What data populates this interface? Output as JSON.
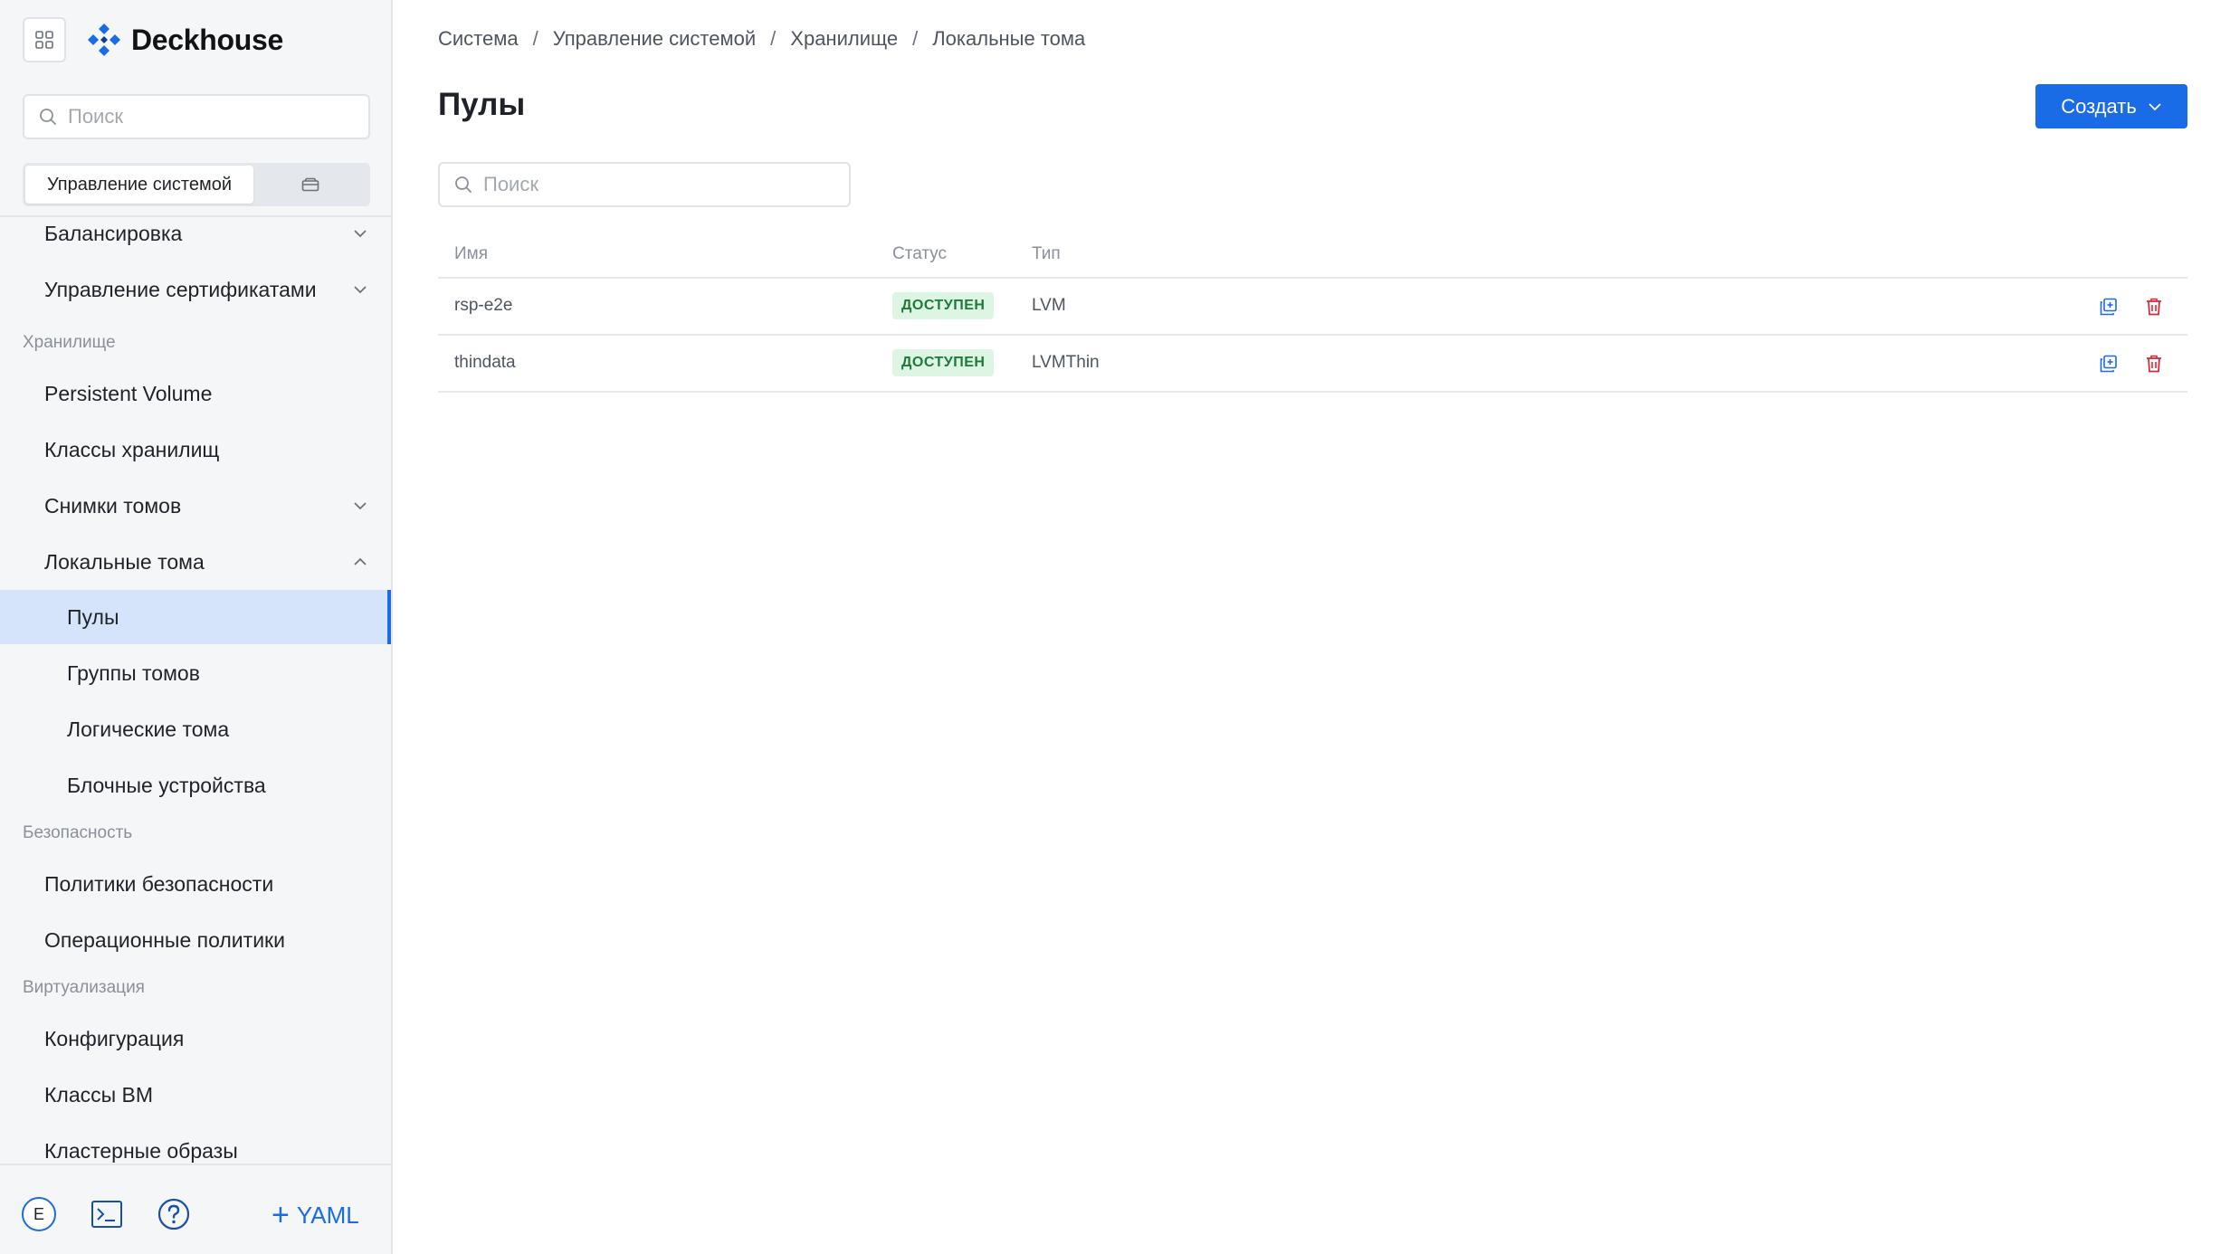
{
  "brand": {
    "name": "Deckhouse",
    "accent": "#1a6be6"
  },
  "sidebar": {
    "search_placeholder": "Поиск",
    "mode_active": "Управление системой",
    "mode_other_icon": "package-icon",
    "items": [
      {
        "label": "Балансировка",
        "expand": "down"
      },
      {
        "label": "Управление сертификатами",
        "expand": "down"
      },
      {
        "section": "Хранилище"
      },
      {
        "label": "Persistent Volume"
      },
      {
        "label": "Классы хранилищ"
      },
      {
        "label": "Снимки томов",
        "expand": "down"
      },
      {
        "label": "Локальные тома",
        "expand": "up"
      },
      {
        "label": "Пулы",
        "active": true
      },
      {
        "label": "Группы томов"
      },
      {
        "label": "Логические тома"
      },
      {
        "label": "Блочные устройства"
      },
      {
        "section": "Безопасность"
      },
      {
        "label": "Политики безопасности"
      },
      {
        "label": "Операционные политики"
      },
      {
        "section": "Виртуализация"
      },
      {
        "label": "Конфигурация"
      },
      {
        "label": "Классы ВМ"
      },
      {
        "label": "Кластерные образы"
      }
    ],
    "footer": {
      "avatar": "E",
      "yaml_label": "YAML"
    }
  },
  "breadcrumb": [
    "Система",
    "Управление системой",
    "Хранилище",
    "Локальные тома"
  ],
  "page": {
    "title": "Пулы",
    "create_label": "Создать",
    "search_placeholder": "Поиск"
  },
  "table": {
    "columns": [
      "Имя",
      "Статус",
      "Тип"
    ],
    "rows": [
      {
        "name": "rsp-e2e",
        "status": "ДОСТУПЕН",
        "type": "LVM"
      },
      {
        "name": "thindata",
        "status": "ДОСТУПЕН",
        "type": "LVMThin"
      }
    ]
  },
  "colors": {
    "status_ok_bg": "#ddf5e3",
    "status_ok_text": "#1d7a3a",
    "delete": "#d92b3a"
  }
}
